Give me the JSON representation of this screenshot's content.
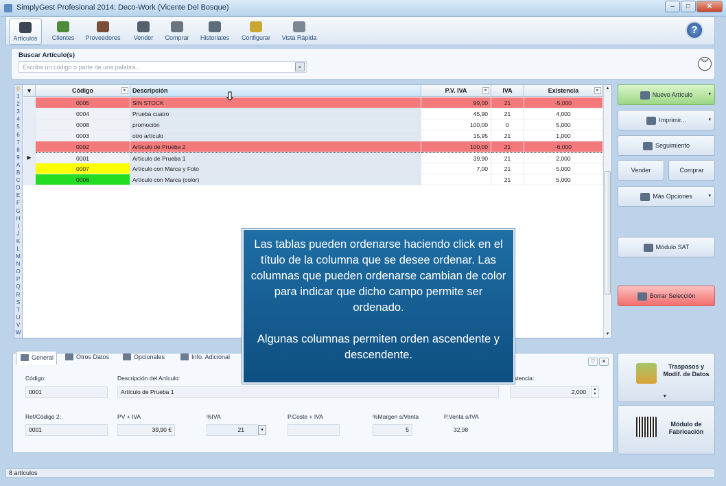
{
  "window": {
    "title": "SimplyGest Profesional 2014: Deco-Work (Vicente Del Bosque)"
  },
  "toolbar": {
    "items": [
      {
        "label": "Artículos",
        "icon": "articles-icon"
      },
      {
        "label": "Clientes",
        "icon": "clients-icon"
      },
      {
        "label": "Proveedores",
        "icon": "suppliers-icon"
      },
      {
        "label": "Vender",
        "icon": "sell-icon"
      },
      {
        "label": "Comprar",
        "icon": "buy-icon"
      },
      {
        "label": "Historiales",
        "icon": "history-icon"
      },
      {
        "label": "Configurar",
        "icon": "settings-icon"
      },
      {
        "label": "Vista Rápida",
        "icon": "quick-view-icon"
      }
    ],
    "help": "?"
  },
  "search": {
    "label": "Buscar Artículo(s)",
    "placeholder": "Escriba un código o parte de una palabra..."
  },
  "grid": {
    "letters": [
      "0",
      "1",
      "2",
      "3",
      "4",
      "5",
      "6",
      "7",
      "8",
      "9",
      "A",
      "B",
      "C",
      "D",
      "E",
      "F",
      "G",
      "H",
      "I",
      "J",
      "K",
      "L",
      "M",
      "N",
      "O",
      "P",
      "Q",
      "R",
      "S",
      "T",
      "U",
      "V",
      "W"
    ],
    "columns": {
      "code": "Código",
      "desc": "Descripción",
      "pv": "P.V. IVA",
      "iva": "IVA",
      "ex": "Existencia"
    },
    "rows": [
      {
        "code": "0005",
        "desc": "SIN STOCK",
        "pv": "99,00",
        "iva": "21",
        "ex": "-5,000"
      },
      {
        "code": "0004",
        "desc": "Prueba cuatro",
        "pv": "45,90",
        "iva": "21",
        "ex": "4,000"
      },
      {
        "code": "0008",
        "desc": "promoción",
        "pv": "100,00",
        "iva": "0",
        "ex": "5,000"
      },
      {
        "code": "0003",
        "desc": "otro artículo",
        "pv": "15,95",
        "iva": "21",
        "ex": "1,000"
      },
      {
        "code": "0002",
        "desc": "Artículo de Prueba 2",
        "pv": "100,00",
        "iva": "21",
        "ex": "-6,000"
      },
      {
        "code": "0001",
        "desc": "Artículo de Prueba 1",
        "pv": "39,90",
        "iva": "21",
        "ex": "2,000"
      },
      {
        "code": "0007",
        "desc": "Artículo con Marca y Foto",
        "pv": "7,00",
        "iva": "21",
        "ex": "5,000"
      },
      {
        "code": "0006",
        "desc": "Artículo con Marca (color)",
        "pv": "",
        "iva": "21",
        "ex": "5,000"
      }
    ]
  },
  "side": {
    "new_article": "Nuevo Artículo",
    "print": "Imprimir...",
    "tracking": "Seguimiento",
    "sell": "Vender",
    "buy": "Comprar",
    "more": "Más Opciones",
    "sat": "Módulo SAT",
    "clear": "Borrar Selección",
    "transfers": "Traspasos y Modif. de Datos",
    "manufacturing": "Módulo de Fabricación"
  },
  "detail": {
    "tabs": [
      "General",
      "Otros Datos",
      "Opcionales",
      "Info. Adicional"
    ],
    "code_label": "Código:",
    "code": "0001",
    "desc_label": "Descripción del Artículo:",
    "desc": "Artículo de Prueba 1",
    "ex_label": "istencia:",
    "ex": "2,000",
    "ref_label": "Ref/Código 2:",
    "ref": "0001",
    "pv_label": "PV + IVA",
    "pv": "39,90",
    "currency": "€",
    "iva_label": "%IVA",
    "iva": "21",
    "cost_label": "P.Coste + IVA",
    "cost": "",
    "margin_label": "%Margen s/Venta",
    "margin": "5",
    "pvsale_label": "P.Venta s/IVA",
    "pvsale": "32,98"
  },
  "status": {
    "text": "8 artículos"
  },
  "overlay": {
    "line1": "Las tablas pueden ordenarse haciendo click en el título de la columna que se desee ordenar. Las columnas que pueden ordenarse cambian de color para indicar que dicho campo permite ser ordenado.",
    "line2": "Algunas columnas permiten orden ascendente y descendente."
  },
  "colors": {
    "red_row": "#f4797a",
    "yellow": "#ffff00",
    "green": "#22dd22",
    "accent": "#1f6ea5"
  }
}
